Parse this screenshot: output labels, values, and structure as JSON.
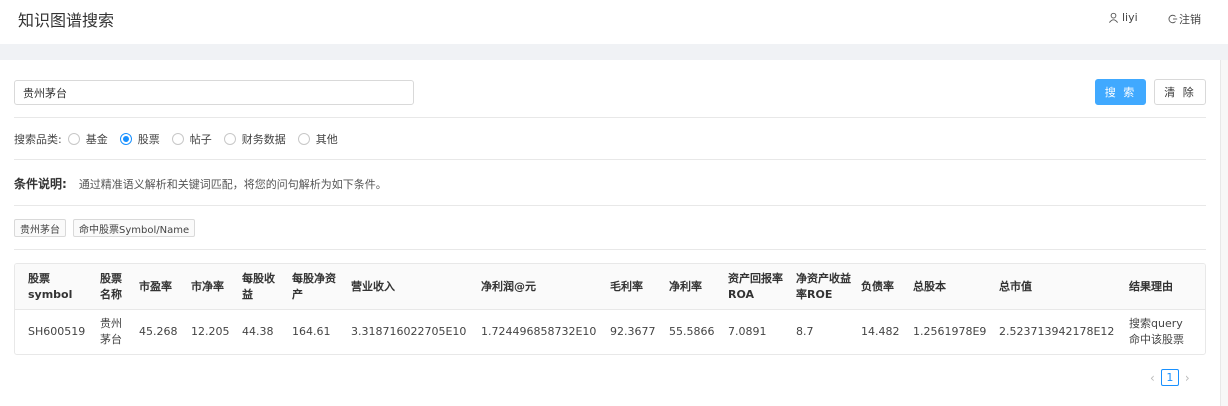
{
  "header": {
    "title": "知识图谱搜索",
    "user_name": "liyi",
    "logout_label": "注销"
  },
  "search": {
    "value": "贵州茅台",
    "search_button": "搜 索",
    "clear_button": "清 除"
  },
  "categories": {
    "label": "搜索品类:",
    "options": [
      "基金",
      "股票",
      "帖子",
      "财务数据",
      "其他"
    ],
    "selected": "股票"
  },
  "condition": {
    "title": "条件说明:",
    "text": "通过精准语义解析和关键词匹配，将您的问句解析为如下条件。"
  },
  "tags": [
    "贵州茅台",
    "命中股票Symbol/Name"
  ],
  "table": {
    "columns": [
      "股票symbol",
      "股票名称",
      "市盈率",
      "市净率",
      "每股收益",
      "每股净资产",
      "营业收入",
      "净利润@元",
      "毛利率",
      "净利率",
      "资产回报率ROA",
      "净资产收益率ROE",
      "负债率",
      "总股本",
      "总市值",
      "结果理由"
    ],
    "rows": [
      [
        "SH600519",
        "贵州茅台",
        "45.268",
        "12.205",
        "44.38",
        "164.61",
        "3.318716022705E10",
        "1.724496858732E10",
        "92.3677",
        "55.5866",
        "7.0891",
        "8.7",
        "14.482",
        "1.2561978E9",
        "2.523713942178E12",
        "搜索query命中该股票"
      ]
    ]
  },
  "pagination": {
    "current": "1",
    "prev": "‹",
    "next": "›"
  }
}
